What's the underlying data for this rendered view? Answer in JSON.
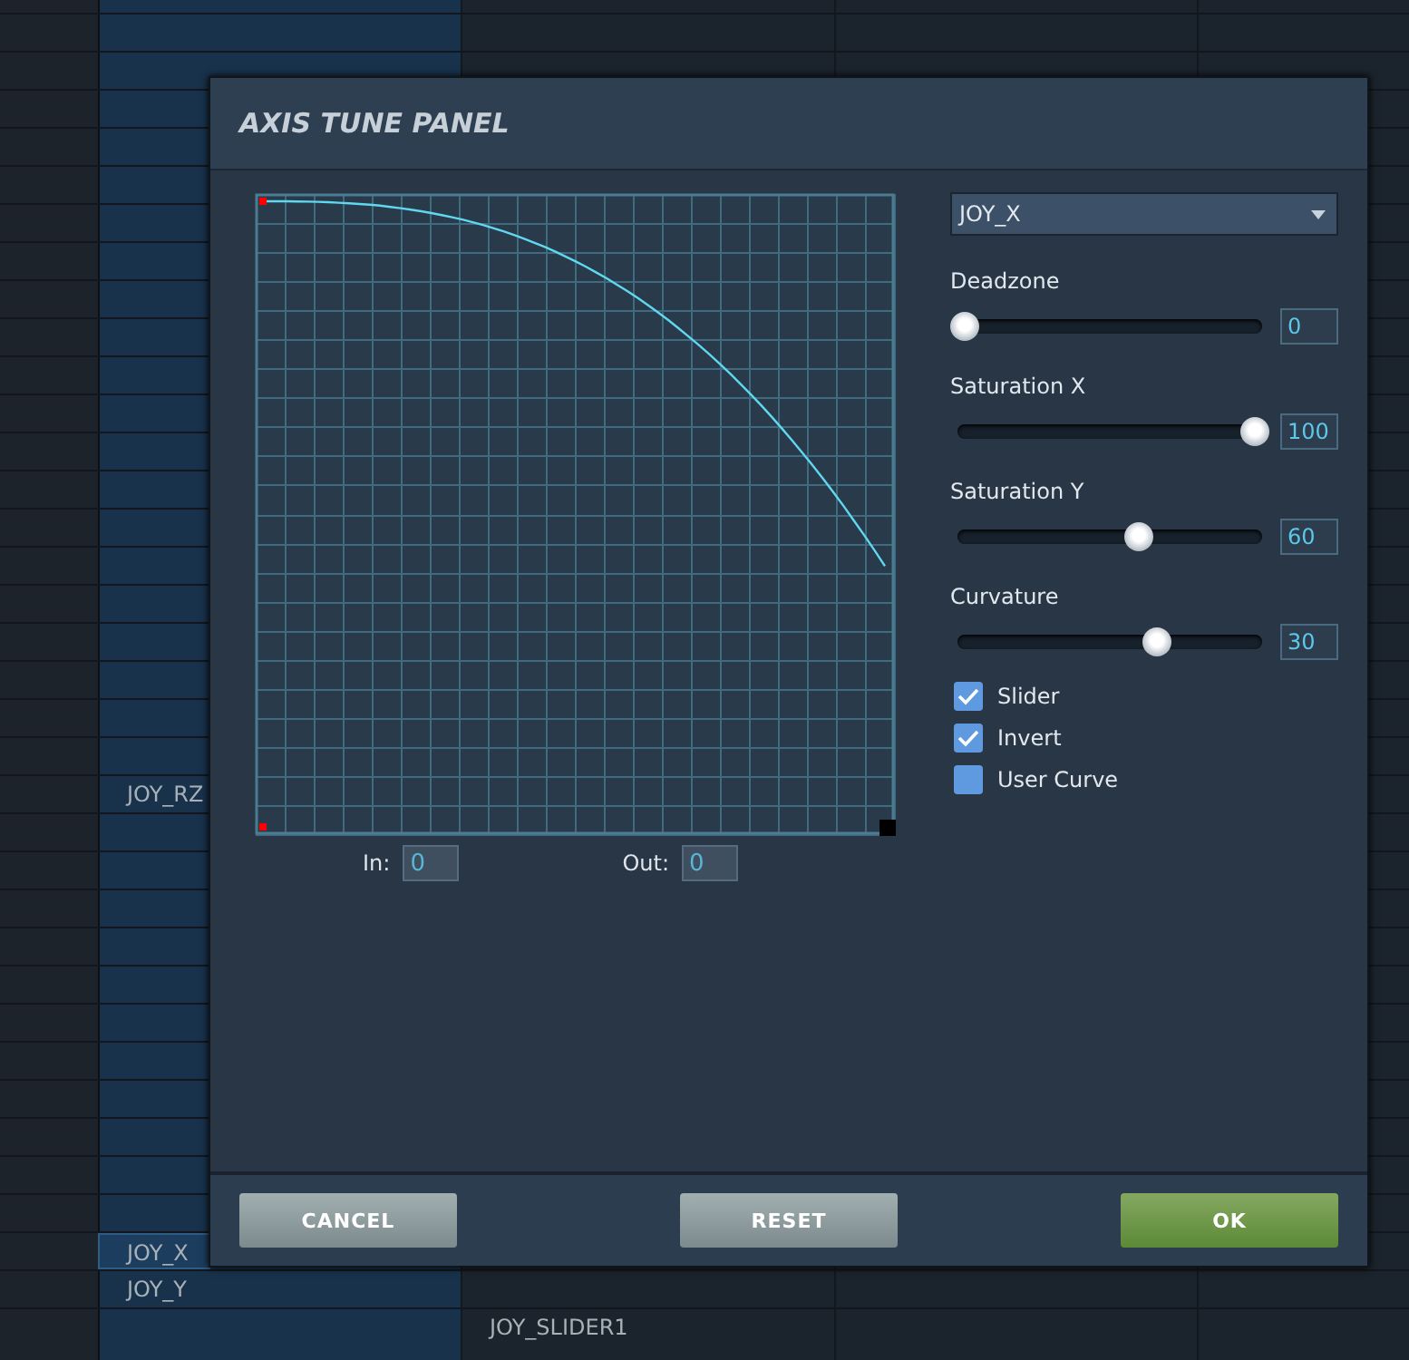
{
  "background_cells": [
    {
      "text": "JOY_RZ",
      "selected": false
    },
    {
      "text": "JOY_X",
      "selected": true
    },
    {
      "text": "JOY_Y",
      "selected": false
    },
    {
      "text": "JOY_SLIDER1",
      "selected": false
    }
  ],
  "dialog": {
    "title": "AXIS TUNE PANEL",
    "axis_dropdown": {
      "value": "JOY_X"
    },
    "sliders": [
      {
        "label": "Deadzone",
        "level": 0,
        "reading": "0"
      },
      {
        "label": "Saturation X",
        "level": 1,
        "reading": "100"
      },
      {
        "label": "Saturation Y",
        "level": 0.6,
        "reading": "60"
      },
      {
        "label": "Curvature",
        "level": 0.66,
        "reading": "30"
      }
    ],
    "checkboxes": [
      {
        "label": "Slider",
        "checked": true
      },
      {
        "label": "Invert",
        "checked": true
      },
      {
        "label": "User Curve",
        "checked": false
      }
    ],
    "in_field": {
      "label": "In:",
      "value": "0"
    },
    "out_field": {
      "label": "Out:",
      "value": "0"
    },
    "buttons": [
      {
        "label": "CANCEL",
        "kind": "secondary"
      },
      {
        "label": "RESET",
        "kind": "secondary"
      },
      {
        "label": "OK",
        "kind": "primary"
      }
    ]
  }
}
